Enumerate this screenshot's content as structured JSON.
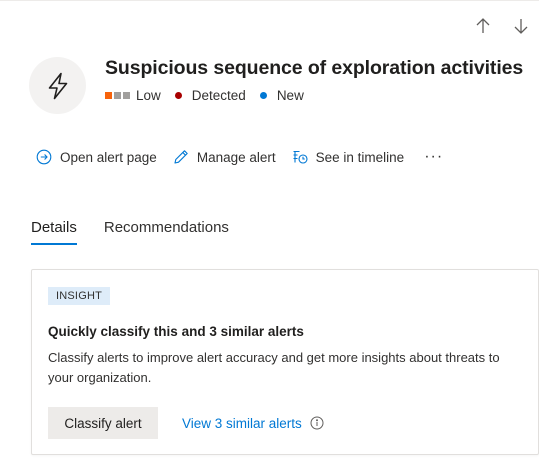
{
  "navigation": {
    "up_icon": "arrow-up-icon",
    "down_icon": "arrow-down-icon"
  },
  "alert": {
    "icon": "lightning-icon",
    "title": "Suspicious sequence of exploration activities",
    "severity": {
      "label": "Low",
      "colors": [
        "#f7630c",
        "#a19f9d",
        "#a19f9d"
      ]
    },
    "detection": {
      "label": "Detected",
      "color": "#a80000"
    },
    "status": {
      "label": "New",
      "color": "#0078d4"
    }
  },
  "actions": [
    {
      "label": "Open alert page",
      "icon": "arrow-circle-right-icon"
    },
    {
      "label": "Manage alert",
      "icon": "pencil-icon"
    },
    {
      "label": "See in timeline",
      "icon": "timeline-icon"
    }
  ],
  "more_label": "···",
  "tabs": [
    {
      "label": "Details",
      "active": true
    },
    {
      "label": "Recommendations",
      "active": false
    }
  ],
  "insight": {
    "badge": "INSIGHT",
    "title": "Quickly classify this and 3 similar alerts",
    "description": "Classify alerts to improve alert accuracy and get more insights about threats to your organization.",
    "classify_label": "Classify alert",
    "similar_label": "View 3 similar alerts",
    "info_icon": "info-icon"
  }
}
